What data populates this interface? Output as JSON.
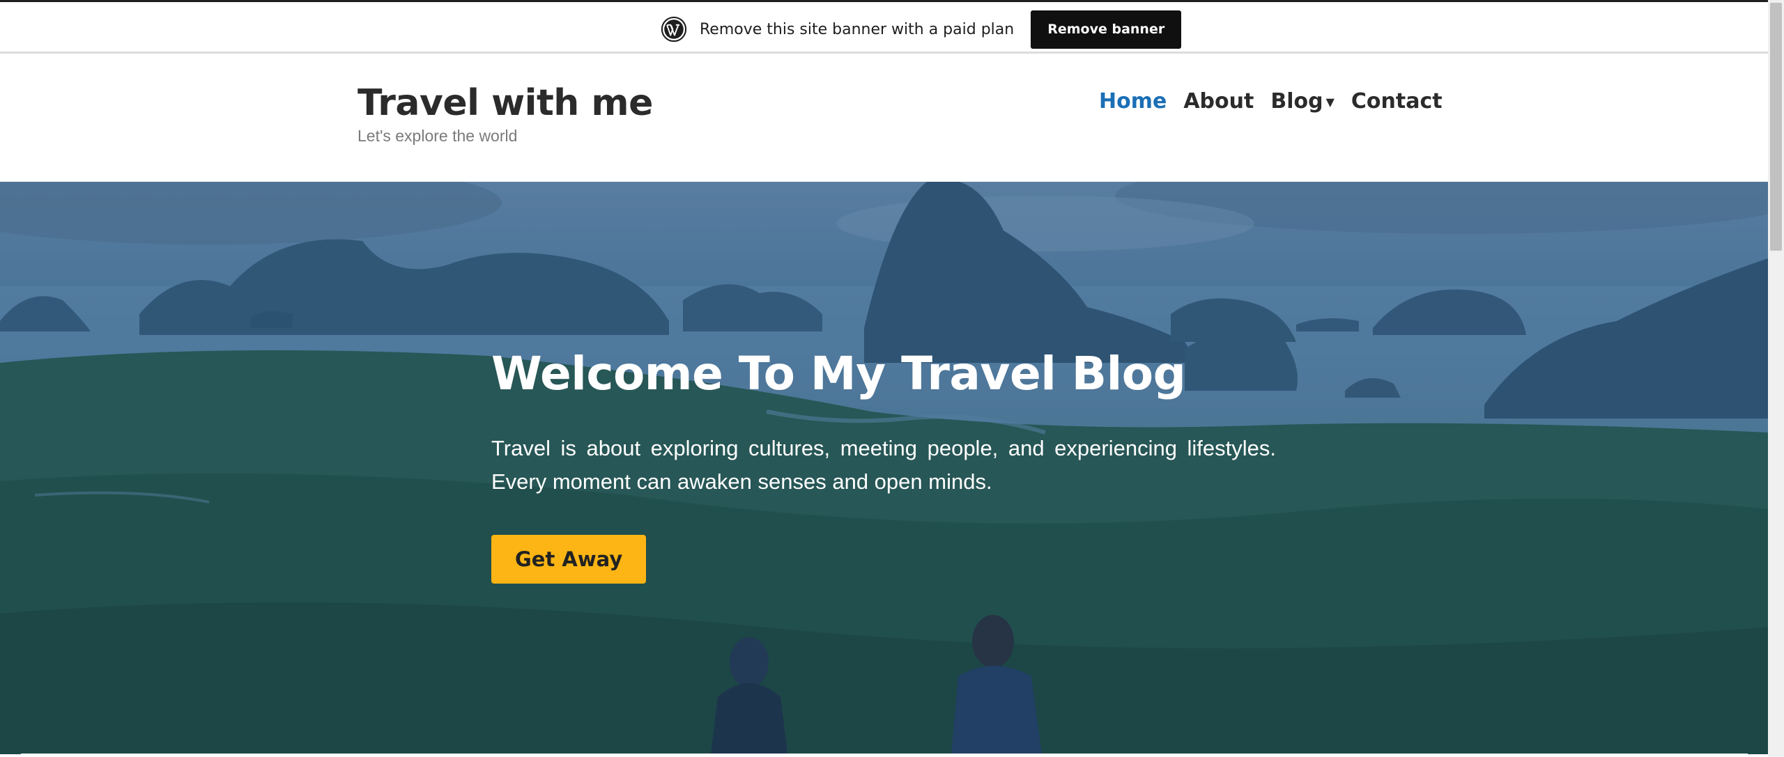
{
  "banner": {
    "icon": "wordpress-logo-icon",
    "text": "Remove this site banner with a paid plan",
    "button_label": "Remove banner"
  },
  "site": {
    "title": "Travel with me",
    "tagline": "Let's explore the world"
  },
  "nav": {
    "items": [
      {
        "label": "Home",
        "active": true
      },
      {
        "label": "About",
        "active": false
      },
      {
        "label": "Blog",
        "active": false,
        "has_dropdown": true
      },
      {
        "label": "Contact",
        "active": false
      }
    ],
    "dropdown_icon": "caret-down-icon"
  },
  "hero": {
    "title": "Welcome To My Travel Blog",
    "text": "Travel is about exploring cultures, meeting people, and experiencing lifestyles. Every moment can awaken senses and open minds.",
    "button_label": "Get Away",
    "background": "aerial-view-of-bay-with-limestone-islands-and-forest"
  },
  "colors": {
    "accent": "#1b6fb5",
    "button": "#fcb514",
    "banner_button": "#101010",
    "text_dark": "#2b2b2b"
  }
}
